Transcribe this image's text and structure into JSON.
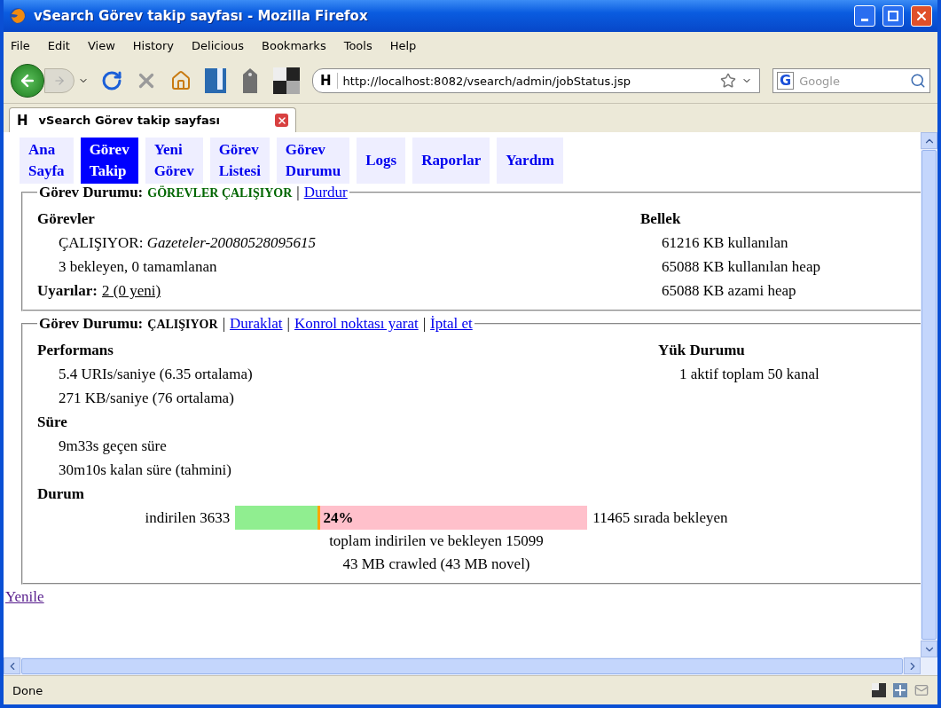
{
  "window": {
    "title": "vSearch Görev takip sayfası - Mozilla Firefox"
  },
  "menu": [
    "File",
    "Edit",
    "View",
    "History",
    "Delicious",
    "Bookmarks",
    "Tools",
    "Help"
  ],
  "toolbar": {
    "site_mark": "H",
    "url": "http://localhost:8082/vsearch/admin/jobStatus.jsp",
    "engine_mark": "G",
    "search_placeholder": "Google"
  },
  "tab": {
    "site_mark": "H",
    "title": "vSearch Görev takip sayfası"
  },
  "nav": [
    {
      "label": "Ana Sayfa",
      "selected": false
    },
    {
      "label": "Görev Takip",
      "selected": true
    },
    {
      "label": "Yeni Görev",
      "selected": false
    },
    {
      "label": "Görev Listesi",
      "selected": false
    },
    {
      "label": "Görev Durumu",
      "selected": false
    },
    {
      "label": "Logs",
      "selected": false
    },
    {
      "label": "Raporlar",
      "selected": false
    },
    {
      "label": "Yardım",
      "selected": false
    }
  ],
  "crawler": {
    "legend": "Görev Durumu:",
    "status": "GÖREVLER ÇALIŞIYOR",
    "separator": "|",
    "actions": [
      "Durdur"
    ],
    "jobs_heading": "Görevler",
    "running_label": "ÇALIŞIYOR:",
    "running_job": "Gazeteler-20080528095615",
    "queue": "3 bekleyen, 0 tamamlanan",
    "alerts_label": "Uyarılar:",
    "alerts_link": "2 (0 yeni)",
    "memory_heading": "Bellek",
    "memory": [
      "61216 KB kullanılan",
      "65088 KB kullanılan heap",
      "65088 KB azami heap"
    ]
  },
  "job": {
    "legend": "Görev Durumu:",
    "status": "ÇALIŞIYOR",
    "separator": "|",
    "actions": [
      "Duraklat",
      "Konrol noktası yarat",
      "İptal et"
    ],
    "performance_heading": "Performans",
    "performance": [
      "5.4 URIs/saniye (6.35 ortalama)",
      "271 KB/saniye (76 ortalama)"
    ],
    "load_heading": "Yük Durumu",
    "load": [
      "1 aktif toplam 50 kanal"
    ],
    "time_heading": "Süre",
    "time": [
      "9m33s geçen süre",
      "30m10s kalan süre (tahmini)"
    ],
    "state_heading": "Durum",
    "progress": {
      "downloaded": "indirilen 3633",
      "level": 0.24,
      "percent": "24%",
      "queued": "11465 sırada bekleyen"
    },
    "summary": [
      "toplam indirilen ve bekleyen 15099",
      "43 MB crawled (43 MB novel)"
    ]
  },
  "refresh_link": "Yenile",
  "status_bar": "Done"
}
